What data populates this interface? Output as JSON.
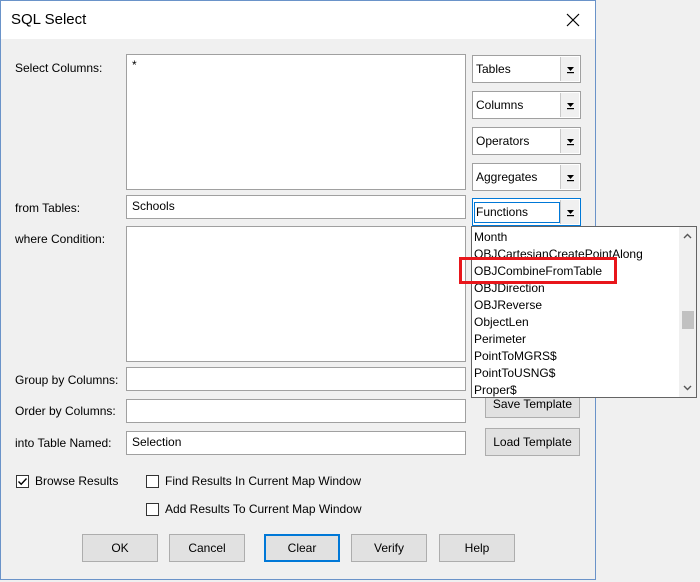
{
  "window": {
    "title": "SQL Select"
  },
  "labels": {
    "select_columns": "Select Columns:",
    "from_tables": "from Tables:",
    "where_condition": "where Condition:",
    "group_by": "Group by Columns:",
    "order_by": "Order by Columns:",
    "into_table": "into Table Named:"
  },
  "fields": {
    "select_columns": "*",
    "from_tables": "Schools",
    "where_condition": "",
    "group_by": "",
    "order_by": "",
    "into_table": "Selection"
  },
  "combos": [
    {
      "label": "Tables"
    },
    {
      "label": "Columns"
    },
    {
      "label": "Operators"
    },
    {
      "label": "Aggregates"
    },
    {
      "label": "Functions"
    }
  ],
  "functions_dropdown": {
    "items": [
      "Month",
      "OBJCartesianCreatePointAlong",
      "OBJCombineFromTable",
      "OBJDirection",
      "OBJReverse",
      "ObjectLen",
      "Perimeter",
      "PointToMGRS$",
      "PointToUSNG$",
      "Proper$"
    ],
    "highlighted": "OBJCombineFromTable"
  },
  "template_buttons": {
    "save": "Save Template",
    "load": "Load Template"
  },
  "checkboxes": [
    {
      "label": "Browse Results",
      "checked": true
    },
    {
      "label": "Find Results In Current Map Window",
      "checked": false
    },
    {
      "label": "Add Results To Current Map Window",
      "checked": false
    }
  ],
  "buttons": {
    "ok": "OK",
    "cancel": "Cancel",
    "clear": "Clear",
    "verify": "Verify",
    "help": "Help"
  },
  "colors": {
    "accent": "#0078d7",
    "highlight_box": "#e8161b"
  }
}
